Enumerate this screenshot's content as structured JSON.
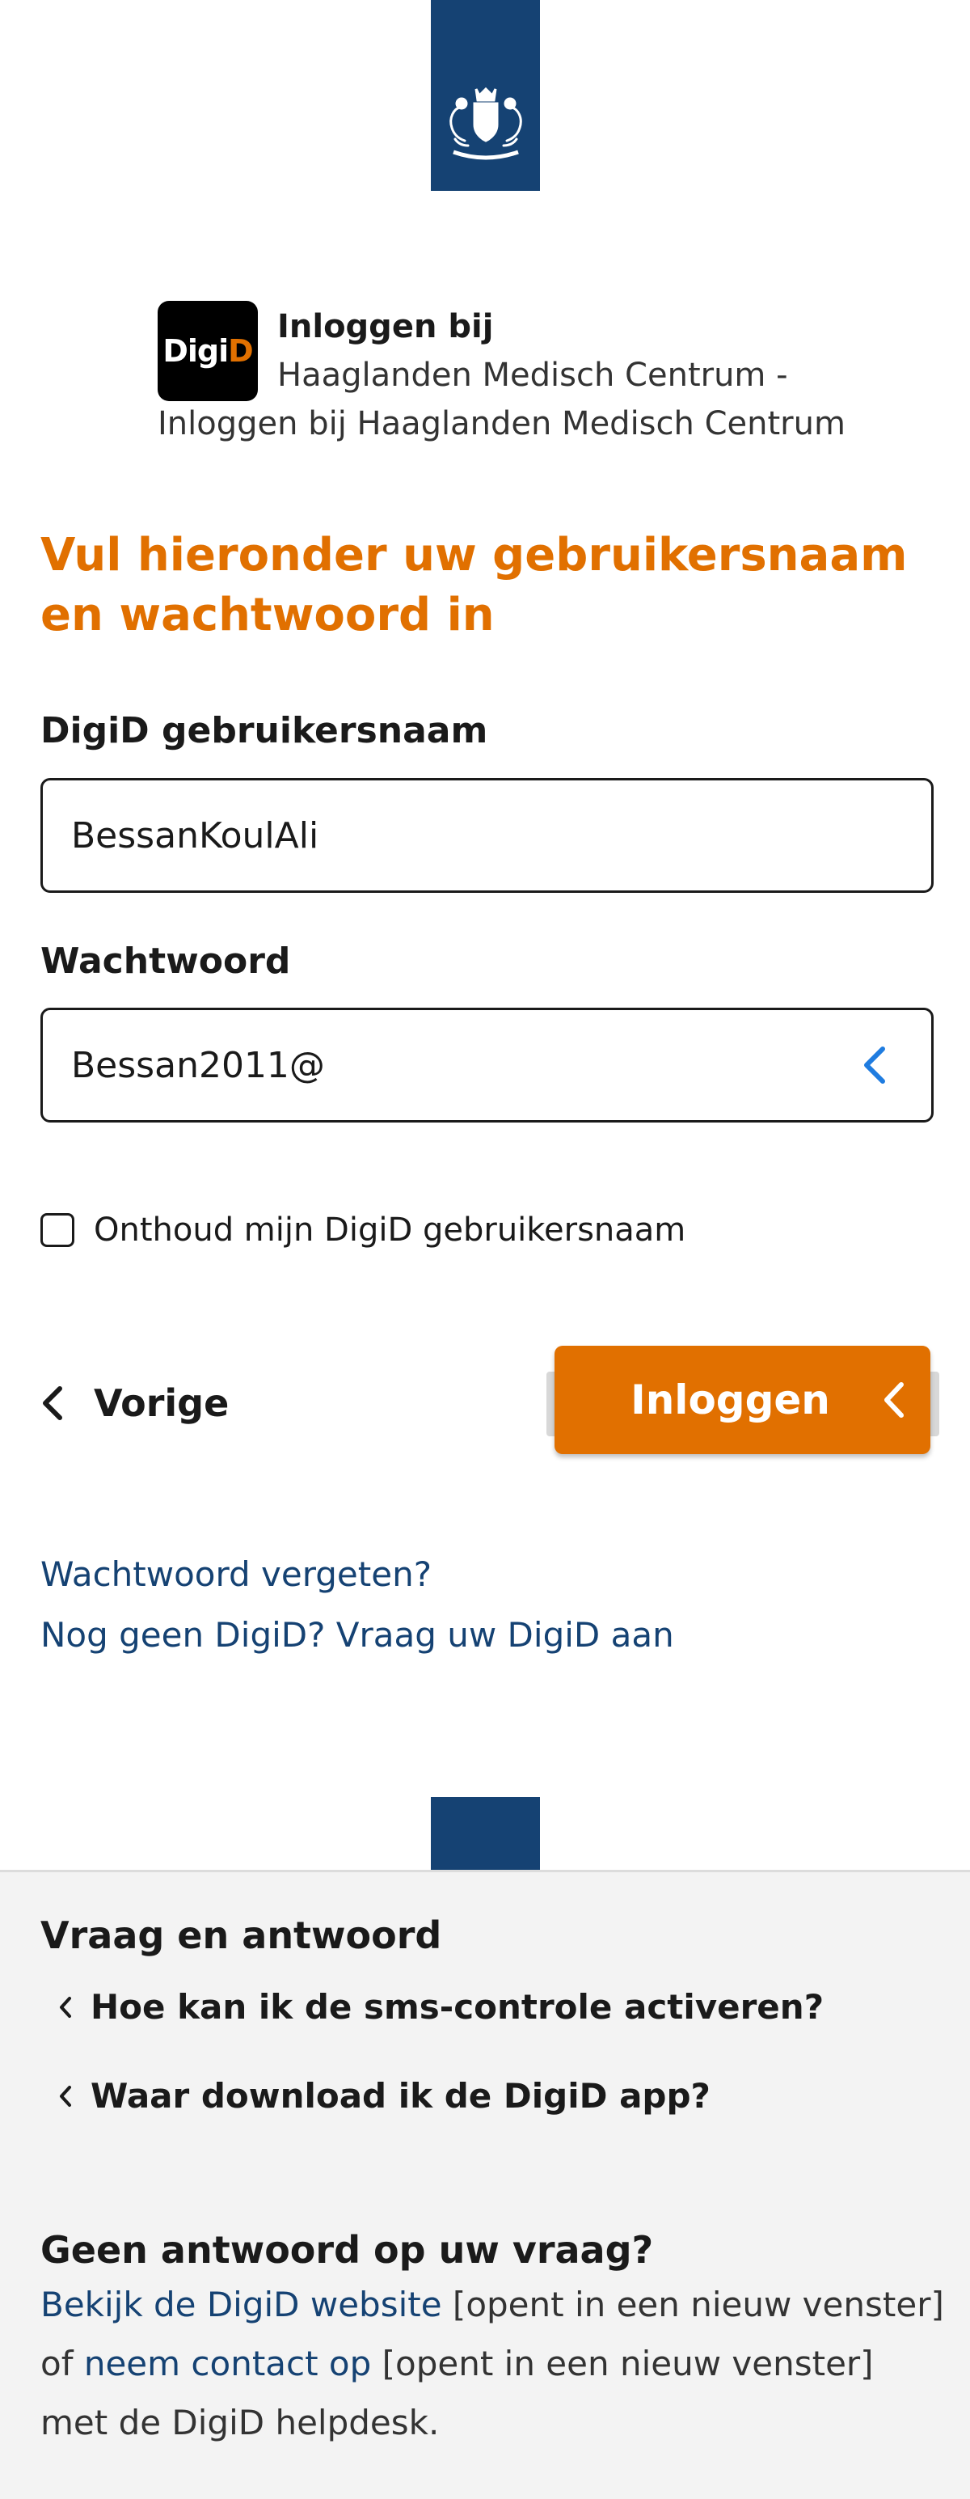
{
  "header": {
    "logo_text_white": "Digi",
    "logo_text_orange": "D",
    "title": "Inloggen bij",
    "service_line1": "Haaglanden Medisch Centrum -",
    "service_line2": "Inloggen bij Haaglanden Medisch Centrum"
  },
  "form": {
    "heading": "Vul hieronder uw gebruikersnaam en wachtwoord in",
    "username_label": "DigiD gebruikersnaam",
    "username_value": "BessanKoulAli",
    "password_label": "Wachtwoord",
    "password_value": "Bessan2011@",
    "remember_label": "Onthoud mijn DigiD gebruikersnaam",
    "back_label": "Vorige",
    "login_label": "Inloggen"
  },
  "links": {
    "forgot_password": "Wachtwoord vergeten?",
    "no_digid": "Nog geen DigiD? Vraag uw DigiD aan"
  },
  "footer": {
    "faq_heading": "Vraag en antwoord",
    "faq_items": [
      "Hoe kan ik de sms-controle activeren?",
      "Waar download ik de DigiD app?"
    ],
    "no_answer_heading": "Geen antwoord op uw vraag?",
    "website_link": "Bekijk de DigiD website",
    "new_window_1": " [opent in een nieuw venster] of ",
    "contact_link": "neem contact op",
    "new_window_2": " [opent in een nieuw venster] met de DigiD helpdesk."
  },
  "colors": {
    "brand_blue": "#154273",
    "accent_orange": "#e17000",
    "link_blue": "#154273",
    "icon_blue": "#1f7ce0"
  },
  "icons": [
    "rijksoverheid-emblem-icon",
    "reveal-password-icon",
    "chevron-left-icon"
  ]
}
